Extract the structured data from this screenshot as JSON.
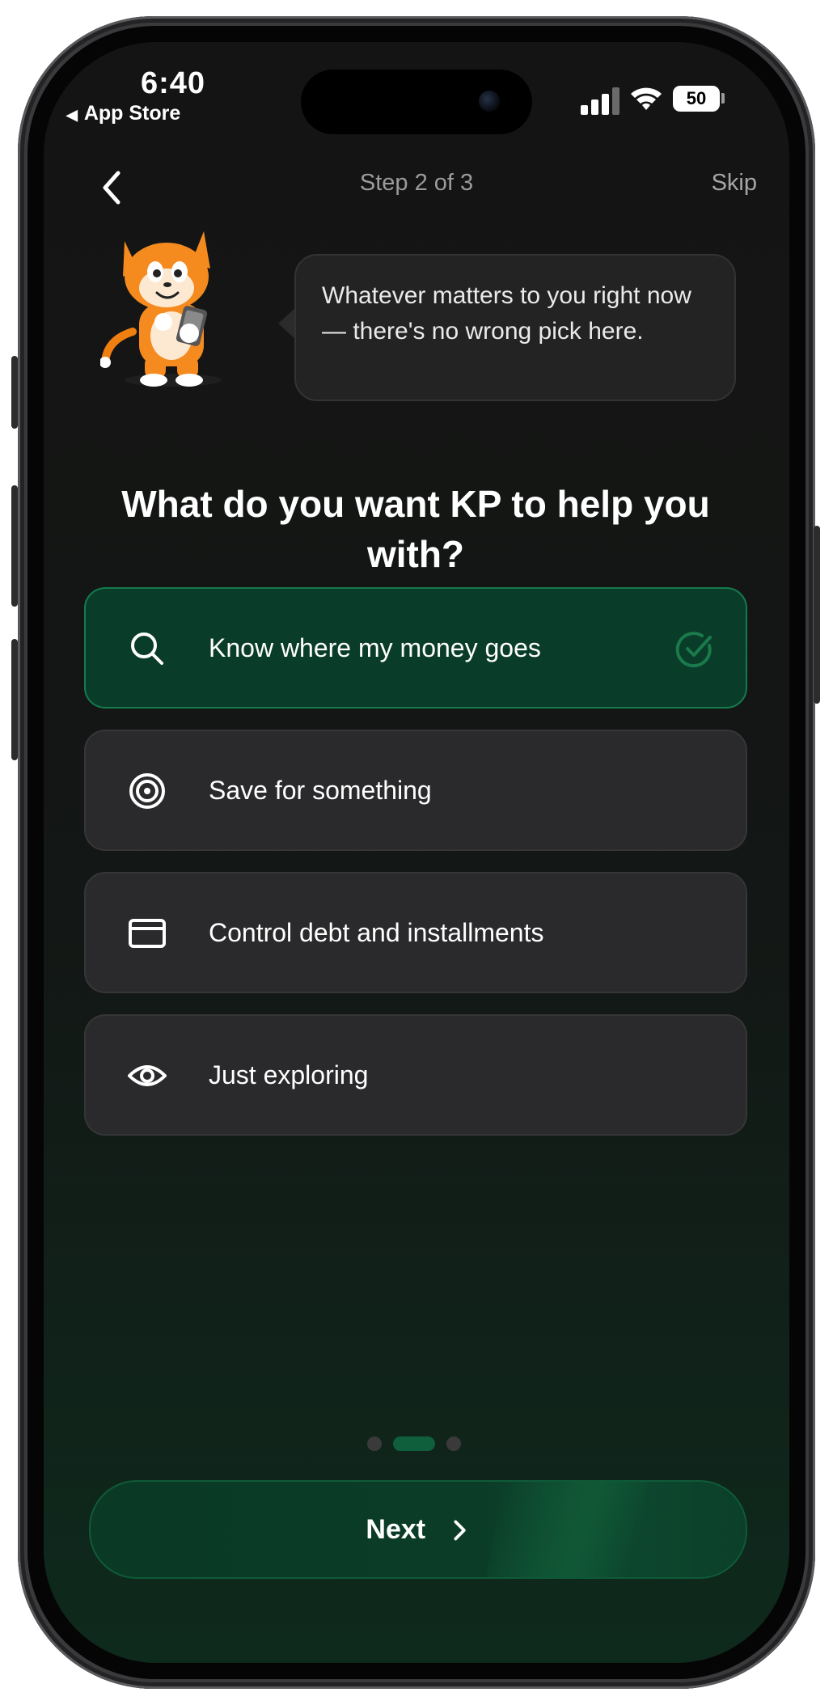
{
  "status_bar": {
    "time": "6:40",
    "back_app": "App Store",
    "battery": "50"
  },
  "header": {
    "step": "Step 2 of 3",
    "skip": "Skip"
  },
  "bubble": {
    "text": "Whatever matters to you right now — there's no wrong pick here."
  },
  "question": "What do you want KP to help you with?",
  "options": [
    {
      "label": "Know where my money goes",
      "icon": "search-icon",
      "selected": true
    },
    {
      "label": "Save for something",
      "icon": "target-icon",
      "selected": false
    },
    {
      "label": "Control debt and installments",
      "icon": "credit-card-icon",
      "selected": false
    },
    {
      "label": "Just exploring",
      "icon": "eye-icon",
      "selected": false
    }
  ],
  "pager": {
    "count": 3,
    "active_index": 1
  },
  "next_button": {
    "label": "Next"
  },
  "colors": {
    "accent": "#0a3d29",
    "accent_border": "#147b4e",
    "card_bg": "#2a2a2c",
    "screen_bg": "#141414"
  }
}
